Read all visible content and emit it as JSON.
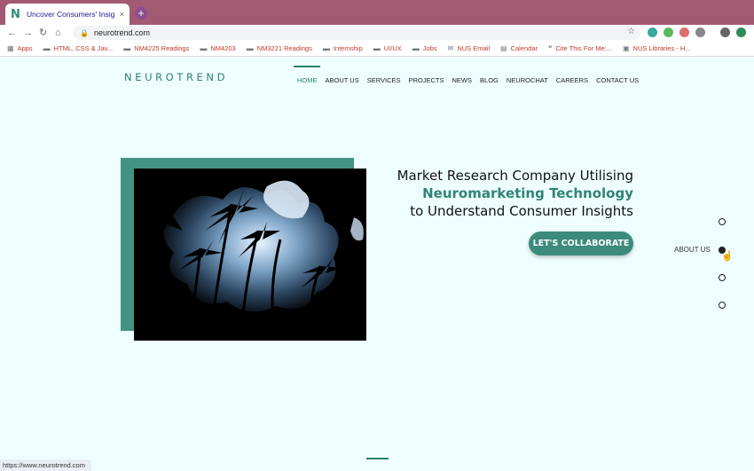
{
  "browser": {
    "tab_title": "Uncover Consumers' Insights",
    "tab_favicon": "N",
    "tab_close": "×",
    "new_tab": "+",
    "url": "neurotrend.com",
    "status_url": "https://www.neurotrend.com",
    "bookmarks": [
      {
        "label": "Apps",
        "icon": "apps-icon"
      },
      {
        "label": "HTML, CSS & Jav...",
        "icon": "folder-icon"
      },
      {
        "label": "NM4225 Readings",
        "icon": "folder-icon"
      },
      {
        "label": "NM4203",
        "icon": "folder-icon"
      },
      {
        "label": "NM3221 Readings",
        "icon": "folder-icon"
      },
      {
        "label": "Internship",
        "icon": "folder-icon"
      },
      {
        "label": "UI/UX",
        "icon": "folder-icon"
      },
      {
        "label": "Jobs",
        "icon": "folder-icon"
      },
      {
        "label": "NUS Email",
        "icon": "outlook-icon"
      },
      {
        "label": "Calendar",
        "icon": "calendar-icon"
      },
      {
        "label": "Cite This For Me:...",
        "icon": "cite-icon"
      },
      {
        "label": "NUS Libraries - H...",
        "icon": "library-icon"
      }
    ]
  },
  "site": {
    "logo": "NEUROTREND",
    "nav": [
      {
        "label": "HOME",
        "active": true
      },
      {
        "label": "ABOUT US",
        "active": false
      },
      {
        "label": "SERVICES",
        "active": false
      },
      {
        "label": "PROJECTS",
        "active": false
      },
      {
        "label": "NEWS",
        "active": false
      },
      {
        "label": "BLOG",
        "active": false
      },
      {
        "label": "NEUROCHAT",
        "active": false
      },
      {
        "label": "CAREERS",
        "active": false
      },
      {
        "label": "CONTACT US",
        "active": false
      }
    ],
    "hero": {
      "line1": "Market Research Company Utilising",
      "line2": "Neuromarketing Technology",
      "line3": "to Understand Consumer Insights",
      "cta": "LET'S COLLABORATE"
    },
    "side_nav_label": "ABOUT US"
  },
  "colors": {
    "accent": "#2f7f72",
    "background": "#eefefe",
    "tabbar": "#a25a73"
  }
}
